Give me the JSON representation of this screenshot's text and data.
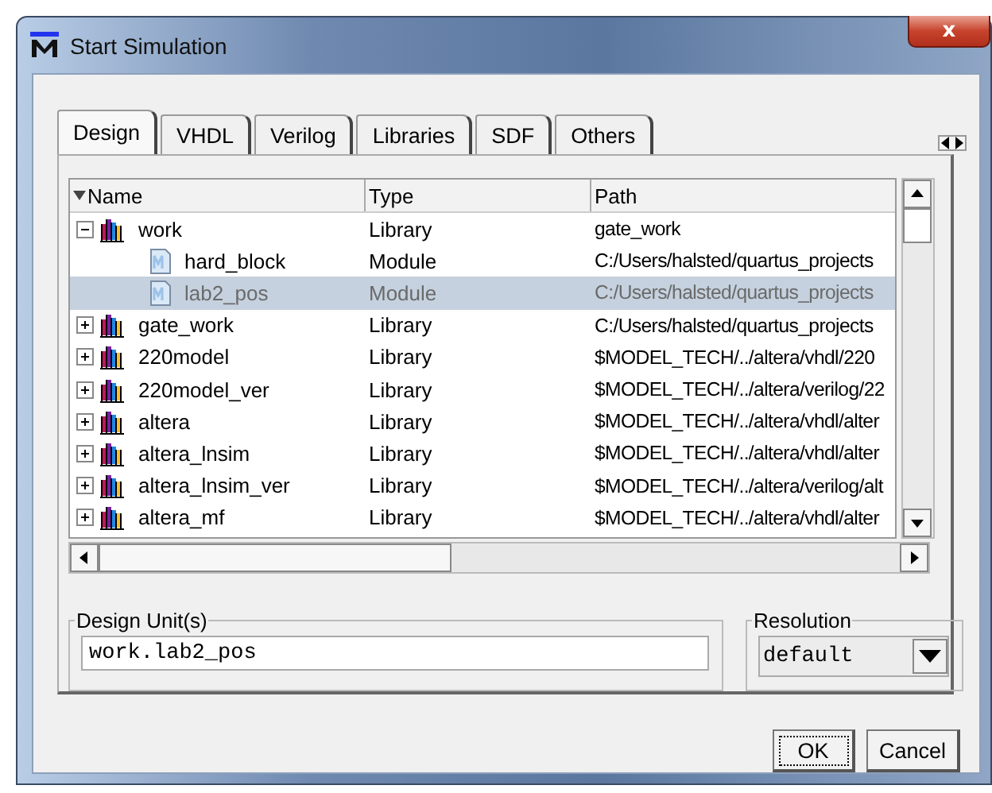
{
  "window": {
    "title": "Start Simulation",
    "close": "x"
  },
  "tabs": [
    {
      "label": "Design",
      "selected": true
    },
    {
      "label": "VHDL",
      "selected": false
    },
    {
      "label": "Verilog",
      "selected": false
    },
    {
      "label": "Libraries",
      "selected": false
    },
    {
      "label": "SDF",
      "selected": false
    },
    {
      "label": "Others",
      "selected": false
    }
  ],
  "tree": {
    "columns": [
      "Name",
      "Type",
      "Path"
    ],
    "items": [
      {
        "kind": "library",
        "name": "work",
        "type": "Library",
        "path": "gate_work",
        "expanded": true,
        "selected": false,
        "children": [
          {
            "kind": "module",
            "name": "hard_block",
            "type": "Module",
            "path": "C:/Users/halsted/quartus_projects",
            "selected": false
          },
          {
            "kind": "module",
            "name": "lab2_pos",
            "type": "Module",
            "path": "C:/Users/halsted/quartus_projects",
            "selected": true
          }
        ]
      },
      {
        "kind": "library",
        "name": "gate_work",
        "type": "Library",
        "path": "C:/Users/halsted/quartus_projects",
        "expanded": false,
        "selected": false
      },
      {
        "kind": "library",
        "name": "220model",
        "type": "Library",
        "path": "$MODEL_TECH/../altera/vhdl/220",
        "expanded": false,
        "selected": false
      },
      {
        "kind": "library",
        "name": "220model_ver",
        "type": "Library",
        "path": "$MODEL_TECH/../altera/verilog/22",
        "expanded": false,
        "selected": false
      },
      {
        "kind": "library",
        "name": "altera",
        "type": "Library",
        "path": "$MODEL_TECH/../altera/vhdl/alter",
        "expanded": false,
        "selected": false
      },
      {
        "kind": "library",
        "name": "altera_lnsim",
        "type": "Library",
        "path": "$MODEL_TECH/../altera/vhdl/alter",
        "expanded": false,
        "selected": false
      },
      {
        "kind": "library",
        "name": "altera_lnsim_ver",
        "type": "Library",
        "path": "$MODEL_TECH/../altera/verilog/alt",
        "expanded": false,
        "selected": false
      },
      {
        "kind": "library",
        "name": "altera_mf",
        "type": "Library",
        "path": "$MODEL_TECH/../altera/vhdl/alter",
        "expanded": false,
        "selected": false
      }
    ]
  },
  "design_units": {
    "label": "Design Unit(s)",
    "value": "work.lab2_pos"
  },
  "resolution": {
    "label": "Resolution",
    "value": "default"
  },
  "buttons": [
    {
      "label": "OK",
      "focused": true
    },
    {
      "label": "Cancel",
      "focused": false
    }
  ]
}
